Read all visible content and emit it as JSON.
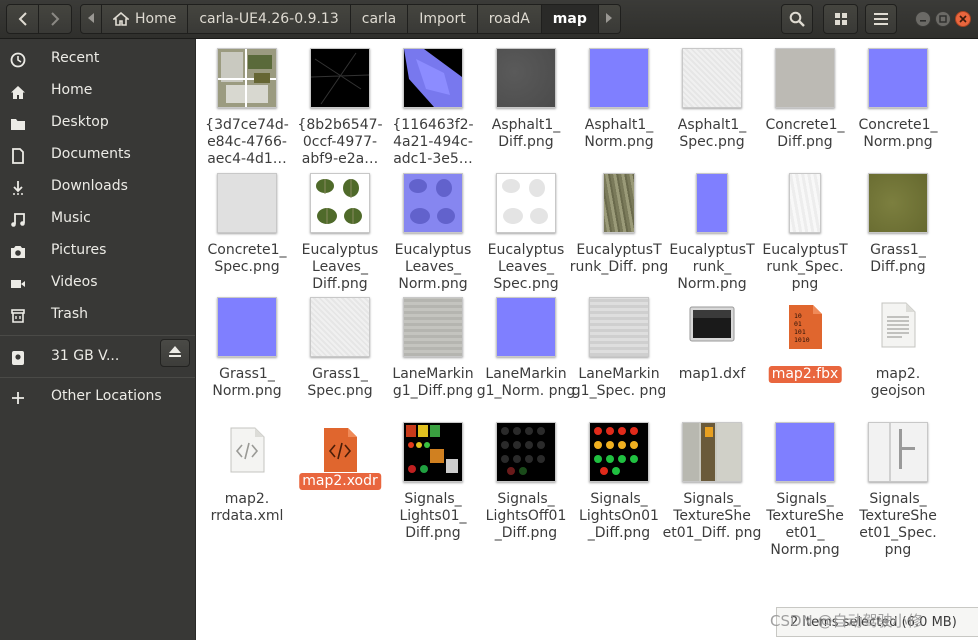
{
  "toolbar": {
    "back_icon": "chevron-left-icon",
    "forward_icon": "chevron-right-icon",
    "search_icon": "search-icon",
    "view_icon": "grid-view-icon",
    "menu_icon": "hamburger-menu-icon"
  },
  "breadcrumb": [
    {
      "label": "Home",
      "icon": "home-icon"
    },
    {
      "label": "carla-UE4.26-0.9.13"
    },
    {
      "label": "carla"
    },
    {
      "label": "Import"
    },
    {
      "label": "roadA"
    },
    {
      "label": "map",
      "active": true
    }
  ],
  "sidebar": {
    "items": [
      {
        "label": "Recent",
        "icon": "clock-icon"
      },
      {
        "label": "Home",
        "icon": "home-icon"
      },
      {
        "label": "Desktop",
        "icon": "folder-icon"
      },
      {
        "label": "Documents",
        "icon": "document-icon"
      },
      {
        "label": "Downloads",
        "icon": "download-icon"
      },
      {
        "label": "Music",
        "icon": "music-icon"
      },
      {
        "label": "Pictures",
        "icon": "camera-icon"
      },
      {
        "label": "Videos",
        "icon": "video-icon"
      },
      {
        "label": "Trash",
        "icon": "trash-icon"
      }
    ],
    "volume": {
      "label": "31 GB V...",
      "icon": "drive-icon",
      "eject_icon": "eject-icon"
    },
    "other": {
      "label": "Other Locations",
      "icon": "plus-icon"
    }
  },
  "files": [
    {
      "name": "{3d7ce74d-e84c-4766-aec4-4d1…",
      "kind": "map-thumb"
    },
    {
      "name": "{8b2b6547-0ccf-4977-abf9-e2a…",
      "kind": "dark-road"
    },
    {
      "name": "{116463f2-4a21-494c-adc1-3e5…",
      "kind": "normal-map"
    },
    {
      "name": "Asphalt1_ Diff.png",
      "kind": "gray-asph"
    },
    {
      "name": "Asphalt1_ Norm.png",
      "kind": "norm-blue"
    },
    {
      "name": "Asphalt1_ Spec.png",
      "kind": "light-spec"
    },
    {
      "name": "Concrete1_ Diff.png",
      "kind": "conc-diff"
    },
    {
      "name": "Concrete1_ Norm.png",
      "kind": "norm-blue"
    },
    {
      "name": "Concrete1_ Spec.png",
      "kind": "conc-spec"
    },
    {
      "name": "Eucalyptus Leaves_ Diff.png",
      "kind": "leaves"
    },
    {
      "name": "Eucalyptus Leaves_ Norm.png",
      "kind": "leaves-norm"
    },
    {
      "name": "Eucalyptus Leaves_ Spec.png",
      "kind": "leaves-spec"
    },
    {
      "name": "EucalyptusT runk_Diff. png",
      "kind": "trunk-diff"
    },
    {
      "name": "EucalyptusT runk_ Norm.png",
      "kind": "trunk-norm"
    },
    {
      "name": "EucalyptusT runk_Spec. png",
      "kind": "trunk-spec"
    },
    {
      "name": "Grass1_ Diff.png",
      "kind": "grass-diff"
    },
    {
      "name": "Grass1_ Norm.png",
      "kind": "norm-blue"
    },
    {
      "name": "Grass1_ Spec.png",
      "kind": "light-spec"
    },
    {
      "name": "LaneMarkin g1_Diff.png",
      "kind": "lane-diff"
    },
    {
      "name": "LaneMarkin g1_Norm. png",
      "kind": "norm-blue"
    },
    {
      "name": "LaneMarkin g1_Spec. png",
      "kind": "lane-spec"
    },
    {
      "name": "map1.dxf",
      "kind": "dxf"
    },
    {
      "name": "map2.fbx",
      "kind": "fbx",
      "selected": true
    },
    {
      "name": "map2. geojson",
      "kind": "text-doc"
    },
    {
      "name": "map2. rrdata.xml",
      "kind": "xml-doc"
    },
    {
      "name": "map2.xodr",
      "kind": "xodr",
      "selected": true
    },
    {
      "name": "Signals_ Lights01_ Diff.png",
      "kind": "signals-lights"
    },
    {
      "name": "Signals_ LightsOff01 _Diff.png",
      "kind": "signals-off"
    },
    {
      "name": "Signals_ LightsOn01 _Diff.png",
      "kind": "signals-on"
    },
    {
      "name": "Signals_ TextureShe et01_Diff. png",
      "kind": "sheet-diff"
    },
    {
      "name": "Signals_ TextureShe et01_ Norm.png",
      "kind": "norm-blue"
    },
    {
      "name": "Signals_ TextureShe et01_Spec. png",
      "kind": "sheet-spec"
    }
  ],
  "fbx_icon_text": [
    "10",
    "01",
    "101",
    "1010"
  ],
  "status": {
    "text": "2 items selected (6.0 MB)"
  },
  "watermark": "CSDN @自动驾驶小修"
}
